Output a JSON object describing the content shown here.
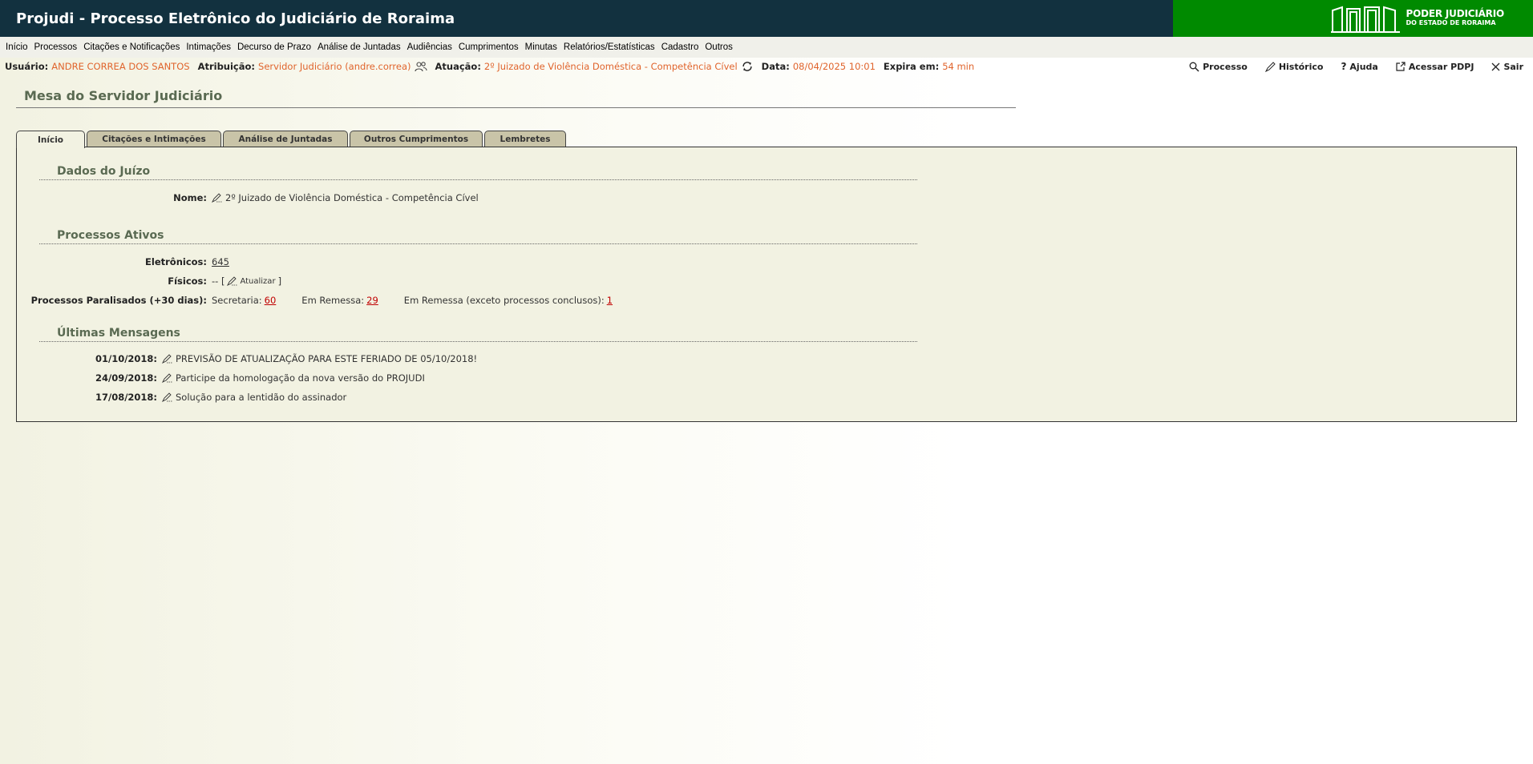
{
  "header": {
    "title": "Projudi - Processo Eletrônico do Judiciário de Roraima",
    "brand_line1": "PODER JUDICIÁRIO",
    "brand_line2": "DO ESTADO DE RORAIMA",
    "brand_color": "#008a00",
    "bar_color": "#12313f"
  },
  "menu": [
    "Início",
    "Processos",
    "Citações e Notificações",
    "Intimações",
    "Decurso de Prazo",
    "Análise de Juntadas",
    "Audiências",
    "Cumprimentos",
    "Minutas",
    "Relatórios/Estatísticas",
    "Cadastro",
    "Outros"
  ],
  "info": {
    "usuario_label": "Usuário:",
    "usuario": "ANDRE CORREA DOS SANTOS",
    "atribuicao_label": "Atribuição:",
    "atribuicao": "Servidor Judiciário (andre.correa)",
    "atuacao_label": "Atuação:",
    "atuacao": "2º Juizado de Violência Doméstica - Competência Cível",
    "data_label": "Data:",
    "data": "08/04/2025 10:01",
    "expira_label": "Expira em:",
    "expira": "54 min",
    "value_color": "#e0642c"
  },
  "links": {
    "processo": "Processo",
    "historico": "Histórico",
    "ajuda": "Ajuda",
    "pdpj": "Acessar PDPJ",
    "sair": "Sair"
  },
  "page_title": "Mesa do Servidor Judiciário",
  "tabs": [
    "Início",
    "Citações e Intimações",
    "Análise de Juntadas",
    "Outros Cumprimentos",
    "Lembretes"
  ],
  "dados_juizo": {
    "heading": "Dados do Juízo",
    "nome_label": "Nome:",
    "nome": "2º Juizado de Violência Doméstica - Competência Cível"
  },
  "processos_ativos": {
    "heading": "Processos Ativos",
    "eletronicos_label": "Eletrônicos:",
    "eletronicos": "645",
    "fisicos_label": "Físicos:",
    "fisicos_prefix": "-- [",
    "fisicos_action": "Atualizar",
    "fisicos_suffix": "]",
    "paralisados_label": "Processos Paralisados (+30 dias):",
    "secretaria_label": "Secretaria:",
    "secretaria": "60",
    "remessa_label": "Em Remessa:",
    "remessa": "29",
    "remessa_exc_label": "Em Remessa (exceto processos conclusos):",
    "remessa_exc": "1"
  },
  "mensagens": {
    "heading": "Últimas Mensagens",
    "items": [
      {
        "date": "01/10/2018:",
        "text": "PREVISÃO DE ATUALIZAÇÃO PARA ESTE FERIADO DE 05/10/2018!"
      },
      {
        "date": "24/09/2018:",
        "text": "Participe da homologação da nova versão do PROJUDI"
      },
      {
        "date": "17/08/2018:",
        "text": "Solução para a lentidão do assinador"
      }
    ]
  }
}
